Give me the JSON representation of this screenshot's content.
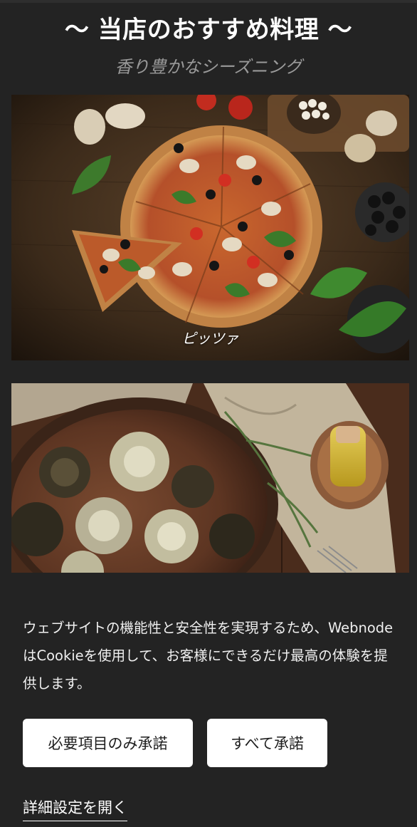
{
  "section": {
    "title": "〜 当店のおすすめ料理 〜",
    "subtitle": "香り豊かなシーズニング"
  },
  "dishes": [
    {
      "caption": "ピッツァ",
      "image": "pizza-photo"
    },
    {
      "caption": "",
      "image": "roasted-artichokes-photo"
    }
  ],
  "cookie_banner": {
    "message": "ウェブサイトの機能性と安全性を実現するため、WebnodeはCookieを使用して、お客様にできるだけ最高の体験を提供します。",
    "accept_necessary_label": "必要項目のみ承諾",
    "accept_all_label": "すべて承諾",
    "settings_link_label": "詳細設定を開く"
  },
  "colors": {
    "background": "#232323",
    "button_bg": "#ffffff",
    "button_text": "#1e1e1e",
    "subtitle": "#9a9a9a"
  }
}
